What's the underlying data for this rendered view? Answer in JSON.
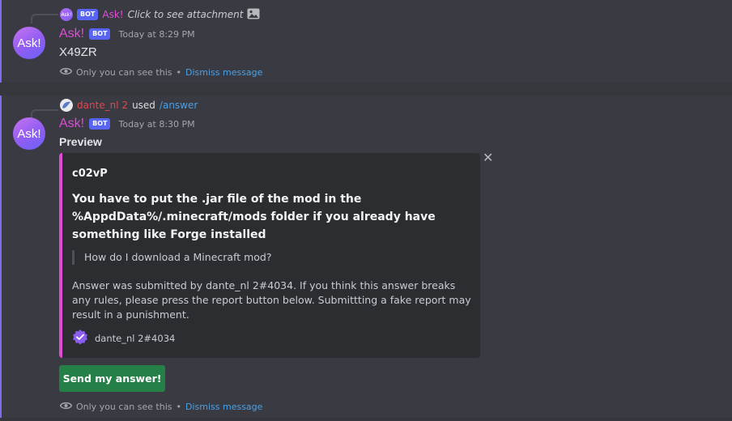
{
  "message1": {
    "reply": {
      "mini_avatar_text": "Ask!",
      "bot_tag": "BOT",
      "username": "Ask!",
      "text": "Click to see attachment",
      "icon": "image-icon"
    },
    "avatar_text": "Ask!",
    "username": "Ask!",
    "bot_tag": "BOT",
    "timestamp": "Today at 8:29 PM",
    "content": "X49ZR",
    "ephemeral": {
      "text": "Only you can see this",
      "separator": "•",
      "dismiss": "Dismiss message"
    }
  },
  "message2": {
    "reply": {
      "username": "dante_nl 2",
      "used": "used",
      "command": "/answer"
    },
    "avatar_text": "Ask!",
    "username": "Ask!",
    "bot_tag": "BOT",
    "timestamp": "Today at 8:30 PM",
    "content": "Preview",
    "embed": {
      "author": "c02vP",
      "title": "You have to put the .jar file of the mod in the %AppdData%/.minecraft/mods folder if you already have something like Forge installed",
      "quote": "How do I download a Minecraft mod?",
      "description": "Answer was submitted by dante_nl 2#4034. If you think this answer breaks any rules, please press the report button below. Submittting a fake report may result in a punishment.",
      "footer": "dante_nl 2#4034",
      "accent_color": "#e14bd9"
    },
    "button_label": "Send my answer!",
    "ephemeral": {
      "text": "Only you can see this",
      "separator": "•",
      "dismiss": "Dismiss message"
    }
  },
  "colors": {
    "background": "#36373d",
    "highlight": "#3a3b42",
    "bot_tag": "#5865f2",
    "username": "#e14bd9",
    "link": "#4aa0e5",
    "button": "#248046"
  }
}
